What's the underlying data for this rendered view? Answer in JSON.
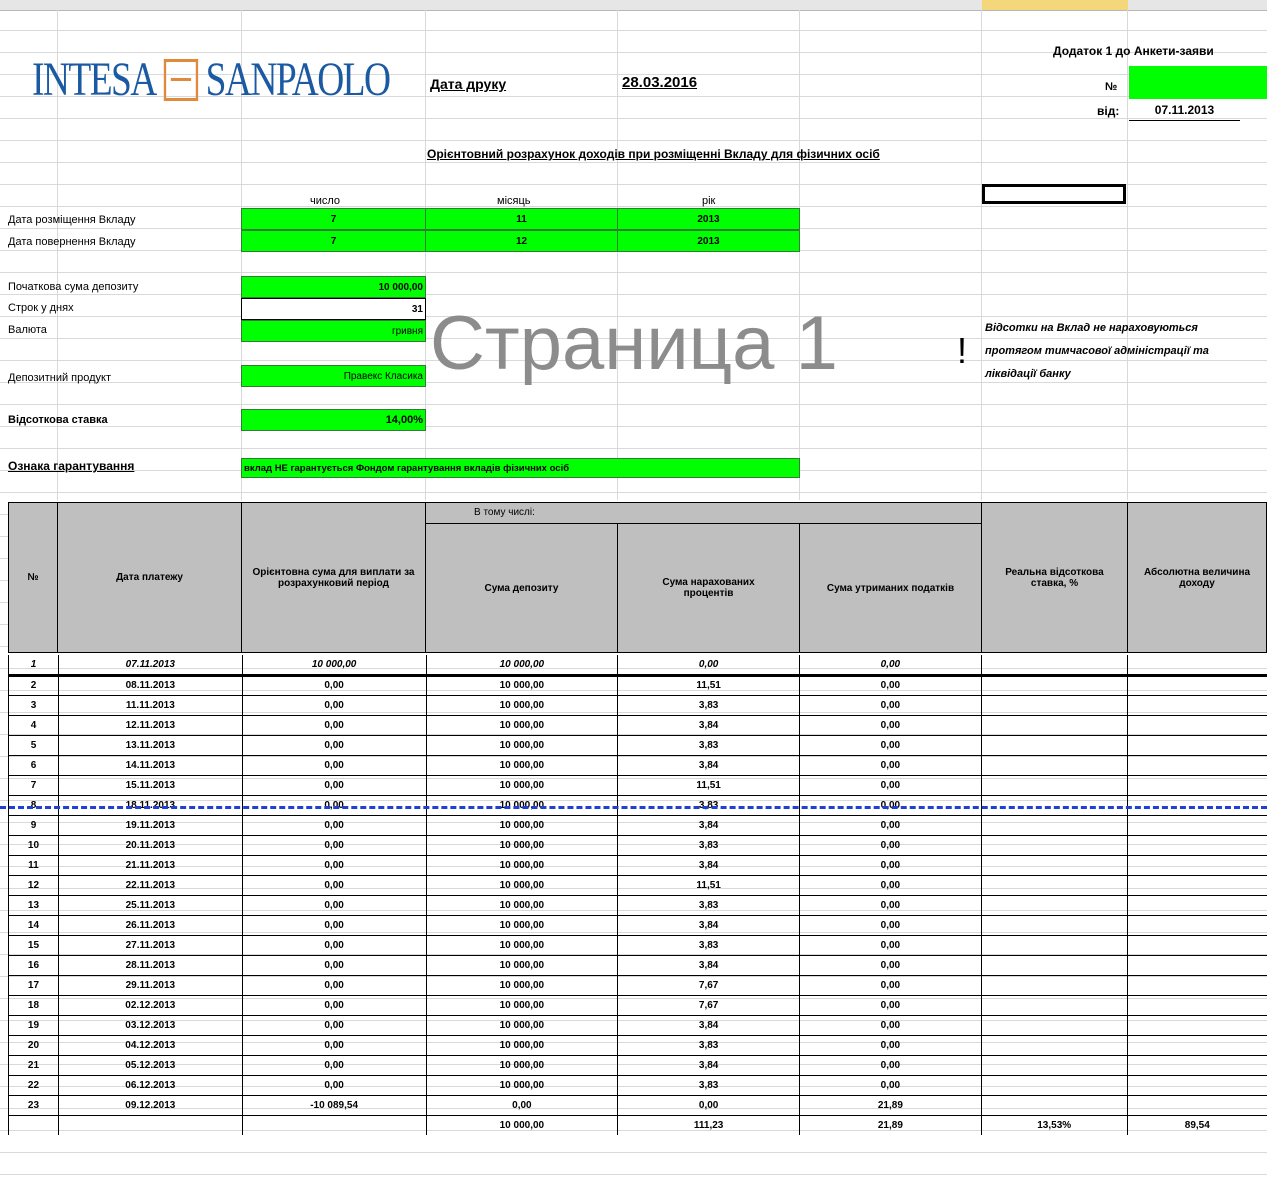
{
  "header": {
    "addendum": "Додаток 1 до Анкети-заяви",
    "print_date_label": "Дата друку",
    "print_date_value": "28.03.2016",
    "no_label": "№",
    "from_label": "від:",
    "from_value": "07.11.2013",
    "logo_left": "INTESA",
    "logo_right": "SANPAOLO"
  },
  "title": "Орієнтовний розрахунок доходів при розміщенні Вкладу для фізичних осіб",
  "date_columns": [
    "число",
    "місяць",
    "рік"
  ],
  "placement": {
    "label": "Дата розміщення Вкладу",
    "day": "7",
    "month": "11",
    "year": "2013"
  },
  "return": {
    "label": "Дата повернення Вкладу",
    "day": "7",
    "month": "12",
    "year": "2013"
  },
  "fields": {
    "initial_sum_label": "Початкова сума депозиту",
    "initial_sum_value": "10 000,00",
    "term_label": "Строк у днях",
    "term_value": "31",
    "currency_label": "Валюта",
    "currency_value": "гривня",
    "product_label": "Депозитний продукт",
    "product_value": "Правекс Класика",
    "rate_label": "Відсоткова ставка",
    "rate_value": "14,00%",
    "guarantee_label": "Ознака гарантування",
    "guarantee_value": "вклад НЕ гарантується Фондом гарантування вкладів фізичних осіб"
  },
  "watermark": "Страница 1",
  "notice": {
    "mark": "!",
    "line1": "Відсотки на Вклад не нараховуються",
    "line2": "протягом тимчасової адміністрації та",
    "line3": "ліквідації банку"
  },
  "table": {
    "group_header": "В тому числі:",
    "columns": [
      "№",
      "Дата платежу",
      "Орієнтовна сума для виплати за розрахунковий період",
      "Сума депозиту",
      "Сума нарахованих процентів",
      "Сума утриманих податків",
      "Реальна відсоткова ставка, %",
      "Абсолютна величина доходу"
    ],
    "rows": [
      [
        "1",
        "07.11.2013",
        "10 000,00",
        "10 000,00",
        "0,00",
        "0,00"
      ],
      [
        "2",
        "08.11.2013",
        "0,00",
        "10 000,00",
        "11,51",
        "0,00"
      ],
      [
        "3",
        "11.11.2013",
        "0,00",
        "10 000,00",
        "3,83",
        "0,00"
      ],
      [
        "4",
        "12.11.2013",
        "0,00",
        "10 000,00",
        "3,84",
        "0,00"
      ],
      [
        "5",
        "13.11.2013",
        "0,00",
        "10 000,00",
        "3,83",
        "0,00"
      ],
      [
        "6",
        "14.11.2013",
        "0,00",
        "10 000,00",
        "3,84",
        "0,00"
      ],
      [
        "7",
        "15.11.2013",
        "0,00",
        "10 000,00",
        "11,51",
        "0,00"
      ],
      [
        "8",
        "18.11.2013",
        "0,00",
        "10 000,00",
        "3,83",
        "0,00"
      ],
      [
        "9",
        "19.11.2013",
        "0,00",
        "10 000,00",
        "3,84",
        "0,00"
      ],
      [
        "10",
        "20.11.2013",
        "0,00",
        "10 000,00",
        "3,83",
        "0,00"
      ],
      [
        "11",
        "21.11.2013",
        "0,00",
        "10 000,00",
        "3,84",
        "0,00"
      ],
      [
        "12",
        "22.11.2013",
        "0,00",
        "10 000,00",
        "11,51",
        "0,00"
      ],
      [
        "13",
        "25.11.2013",
        "0,00",
        "10 000,00",
        "3,83",
        "0,00"
      ],
      [
        "14",
        "26.11.2013",
        "0,00",
        "10 000,00",
        "3,84",
        "0,00"
      ],
      [
        "15",
        "27.11.2013",
        "0,00",
        "10 000,00",
        "3,83",
        "0,00"
      ],
      [
        "16",
        "28.11.2013",
        "0,00",
        "10 000,00",
        "3,84",
        "0,00"
      ],
      [
        "17",
        "29.11.2013",
        "0,00",
        "10 000,00",
        "7,67",
        "0,00"
      ],
      [
        "18",
        "02.12.2013",
        "0,00",
        "10 000,00",
        "7,67",
        "0,00"
      ],
      [
        "19",
        "03.12.2013",
        "0,00",
        "10 000,00",
        "3,84",
        "0,00"
      ],
      [
        "20",
        "04.12.2013",
        "0,00",
        "10 000,00",
        "3,83",
        "0,00"
      ],
      [
        "21",
        "05.12.2013",
        "0,00",
        "10 000,00",
        "3,84",
        "0,00"
      ],
      [
        "22",
        "06.12.2013",
        "0,00",
        "10 000,00",
        "3,83",
        "0,00"
      ],
      [
        "23",
        "09.12.2013",
        "-10 089,54",
        "0,00",
        "0,00",
        "21,89"
      ]
    ],
    "totals": [
      "",
      "",
      "",
      "10 000,00",
      "111,23",
      "21,89",
      "13,53%",
      "89,54"
    ]
  }
}
